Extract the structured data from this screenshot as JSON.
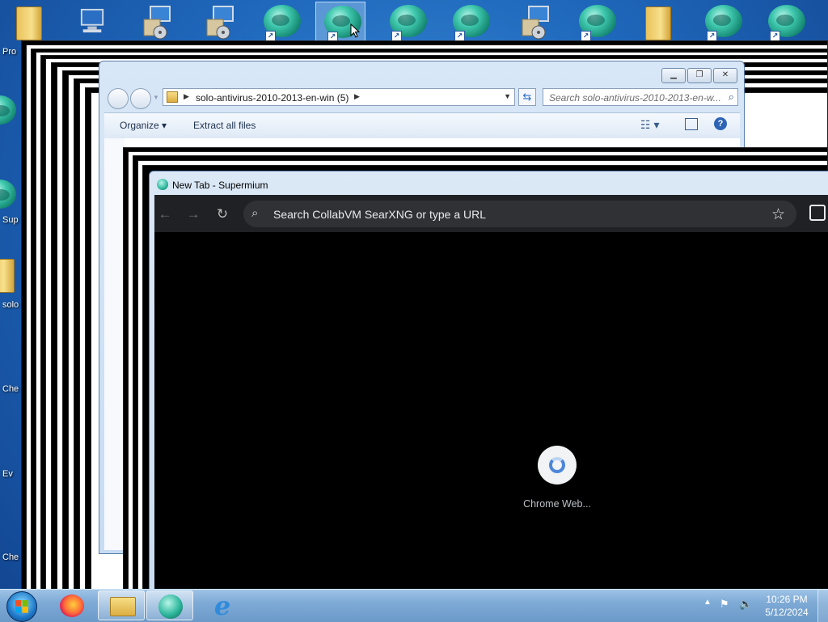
{
  "desktop": {
    "left_labels": [
      "Pro",
      "Sup",
      "solo",
      "Che",
      "Ev",
      "Che"
    ],
    "top_icons": [
      {
        "icon": "folder-icon"
      },
      {
        "icon": "computer-icon"
      },
      {
        "icon": "installer-icon"
      },
      {
        "icon": "installer-icon"
      },
      {
        "icon": "supermium-icon"
      },
      {
        "icon": "supermium-icon",
        "selected": true
      },
      {
        "icon": "supermium-icon"
      },
      {
        "icon": "supermium-icon"
      },
      {
        "icon": "installer-icon"
      },
      {
        "icon": "supermium-icon"
      },
      {
        "icon": "zip-folder-icon"
      },
      {
        "icon": "supermium-icon"
      },
      {
        "icon": "supermium-icon"
      }
    ]
  },
  "explorer": {
    "address_path": "solo-antivirus-2010-2013-en-win (5)",
    "search_placeholder": "Search solo-antivirus-2010-2013-en-w...",
    "toolbar": {
      "organize": "Organize",
      "extract_all": "Extract all files"
    }
  },
  "browser": {
    "title": "New Tab - Supermium",
    "omnibox_placeholder": "Search CollabVM SearXNG or type a URL",
    "shortcut_label": "Chrome Web..."
  },
  "taskbar": {
    "time": "10:26 PM",
    "date": "5/12/2024"
  },
  "colors": {
    "browser_bg": "#000000",
    "chrome_toolbar": "#202124",
    "omnibox": "#303134",
    "taskbar": "#7eaad6"
  }
}
